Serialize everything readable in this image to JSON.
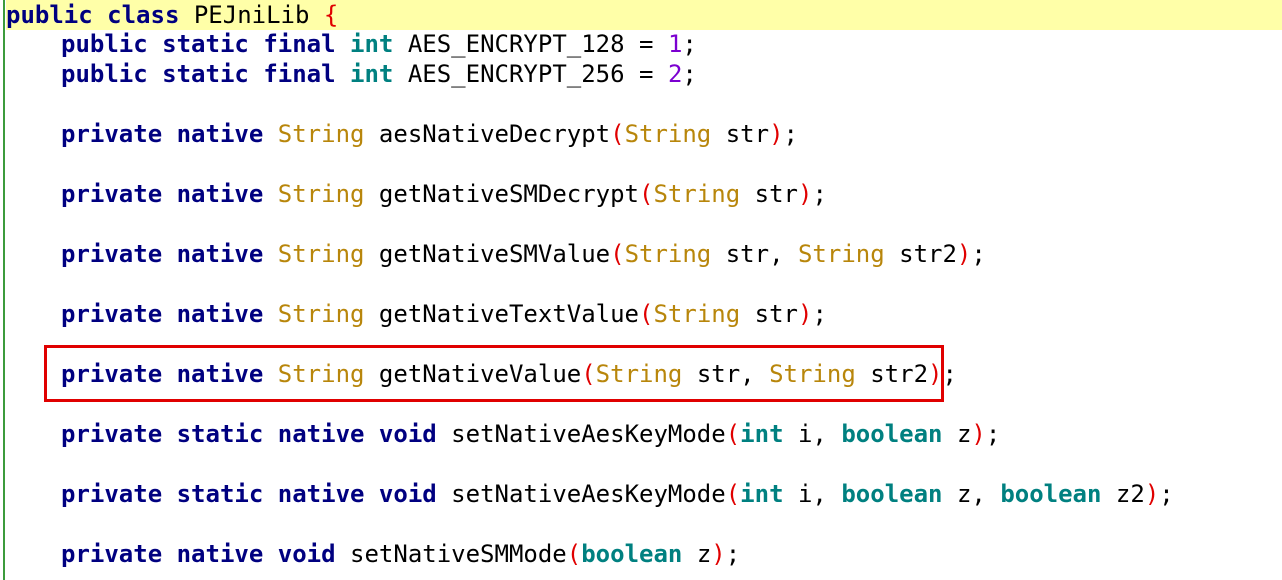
{
  "code": {
    "l0": {
      "kw1": "public",
      "kw2": "class",
      "name": "PEJniLib",
      "brace": "{"
    },
    "l1": {
      "kw1": "public",
      "kw2": "static",
      "kw3": "final",
      "type": "int",
      "name": "AES_ENCRYPT_128",
      "eq": "=",
      "val": "1",
      "semi": ";"
    },
    "l2": {
      "kw1": "public",
      "kw2": "static",
      "kw3": "final",
      "type": "int",
      "name": "AES_ENCRYPT_256",
      "eq": "=",
      "val": "2",
      "semi": ";"
    },
    "l4": {
      "kw1": "private",
      "kw2": "native",
      "ret": "String",
      "name": "aesNativeDecrypt",
      "open": "(",
      "p1t": "String",
      "p1n": "str",
      "close": ")",
      "semi": ";"
    },
    "l6": {
      "kw1": "private",
      "kw2": "native",
      "ret": "String",
      "name": "getNativeSMDecrypt",
      "open": "(",
      "p1t": "String",
      "p1n": "str",
      "close": ")",
      "semi": ";"
    },
    "l8": {
      "kw1": "private",
      "kw2": "native",
      "ret": "String",
      "name": "getNativeSMValue",
      "open": "(",
      "p1t": "String",
      "p1n": "str,",
      "p2t": "String",
      "p2n": "str2",
      "close": ")",
      "semi": ";"
    },
    "l10": {
      "kw1": "private",
      "kw2": "native",
      "ret": "String",
      "name": "getNativeTextValue",
      "open": "(",
      "p1t": "String",
      "p1n": "str",
      "close": ")",
      "semi": ";"
    },
    "l12": {
      "kw1": "private",
      "kw2": "native",
      "ret": "String",
      "name": "getNativeValue",
      "open": "(",
      "p1t": "String",
      "p1n": "str,",
      "p2t": "String",
      "p2n": "str2",
      "close": ")",
      "semi": ";"
    },
    "l14": {
      "kw1": "private",
      "kw2": "static",
      "kw3": "native",
      "ret": "void",
      "name": "setNativeAesKeyMode",
      "open": "(",
      "p1t": "int",
      "p1n": "i,",
      "p2t": "boolean",
      "p2n": "z",
      "close": ")",
      "semi": ";"
    },
    "l16": {
      "kw1": "private",
      "kw2": "static",
      "kw3": "native",
      "ret": "void",
      "name": "setNativeAesKeyMode",
      "open": "(",
      "p1t": "int",
      "p1n": "i,",
      "p2t": "boolean",
      "p2n": "z,",
      "p3t": "boolean",
      "p3n": "z2",
      "close": ")",
      "semi": ";"
    },
    "l18": {
      "kw1": "private",
      "kw2": "native",
      "ret": "void",
      "name": "setNativeSMMode",
      "open": "(",
      "p1t": "boolean",
      "p1n": "z",
      "close": ")",
      "semi": ";"
    }
  },
  "colors": {
    "keyword": "#000080",
    "primitive": "#008080",
    "type": "#b8860b",
    "number": "#7b00d0",
    "paren": "#e00000",
    "current_line": "#ffffa8",
    "highlight_box": "#e00000"
  }
}
